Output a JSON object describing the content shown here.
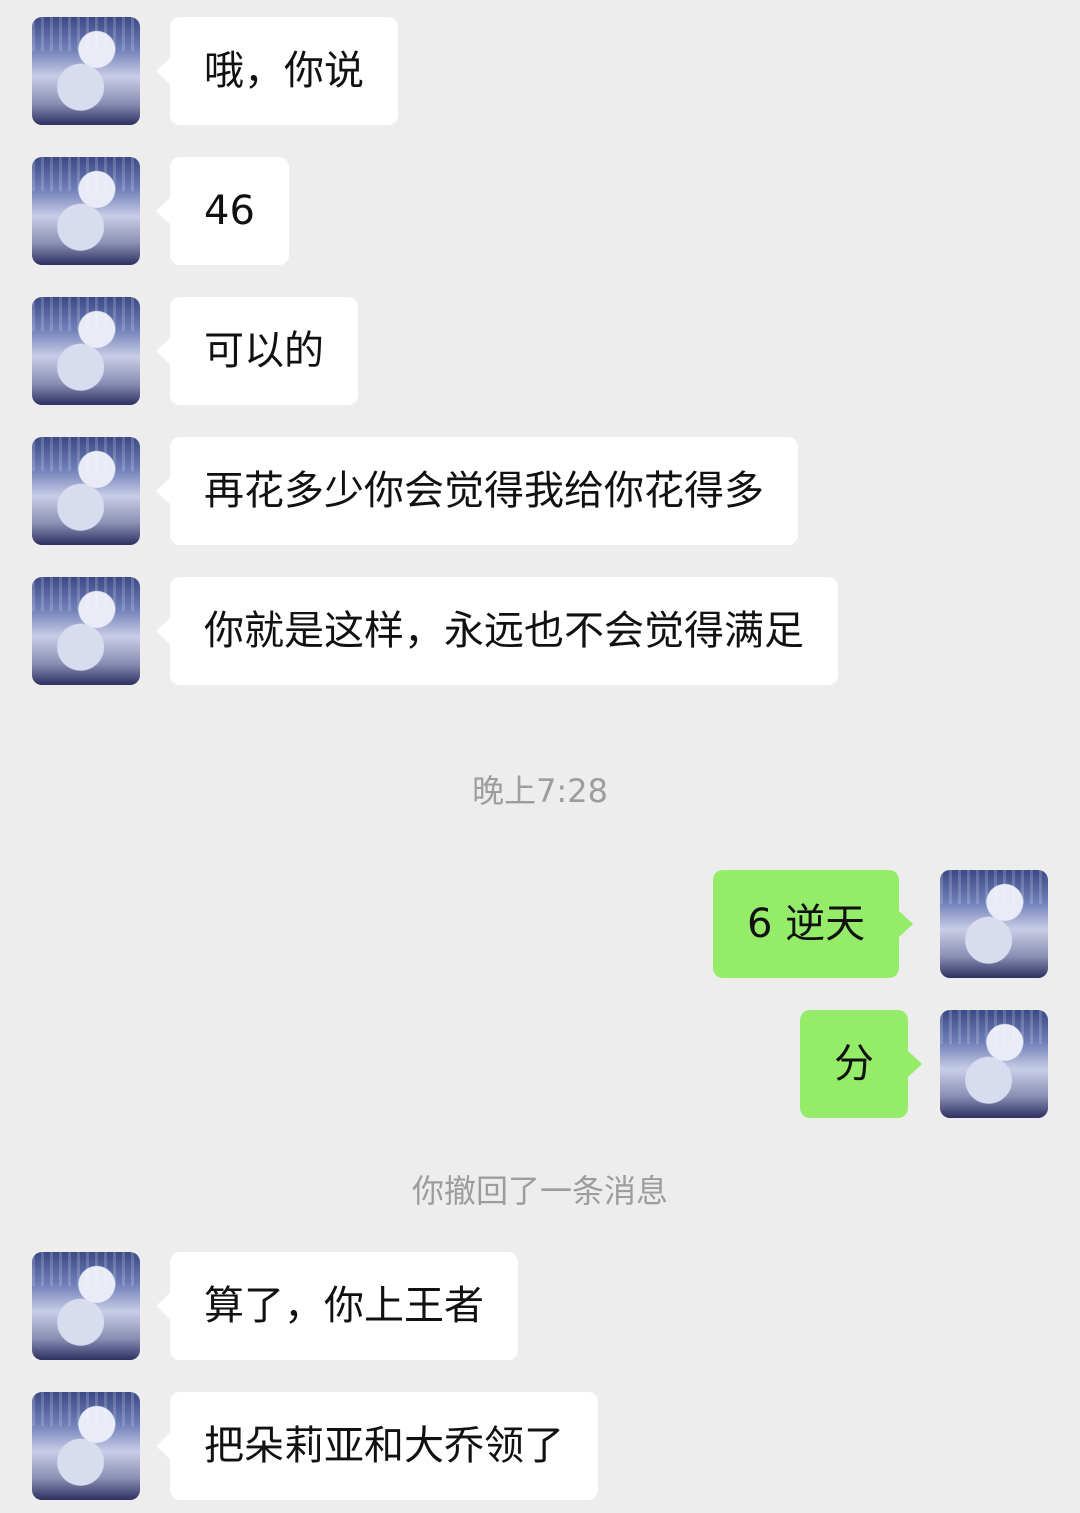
{
  "messages": [
    {
      "side": "left",
      "text": "哦，你说"
    },
    {
      "side": "left",
      "text": "46"
    },
    {
      "side": "left",
      "text": "可以的"
    },
    {
      "side": "left",
      "text": "再花多少你会觉得我给你花得多"
    },
    {
      "side": "left",
      "text": "你就是这样，永远也不会觉得满足"
    },
    {
      "side": "system",
      "text": "晚上7:28"
    },
    {
      "side": "right",
      "text": "6 逆天"
    },
    {
      "side": "right",
      "text": "分"
    },
    {
      "side": "system",
      "text": "你撤回了一条消息"
    },
    {
      "side": "left",
      "text": "算了，你上王者"
    },
    {
      "side": "left",
      "text": "把朵莉亚和大乔领了"
    }
  ],
  "colors": {
    "background": "#ededed",
    "incoming_bubble": "#ffffff",
    "outgoing_bubble": "#95ec69",
    "system_text": "#9d9d9d"
  },
  "icons": {
    "avatar": "anime-avatar-image"
  }
}
